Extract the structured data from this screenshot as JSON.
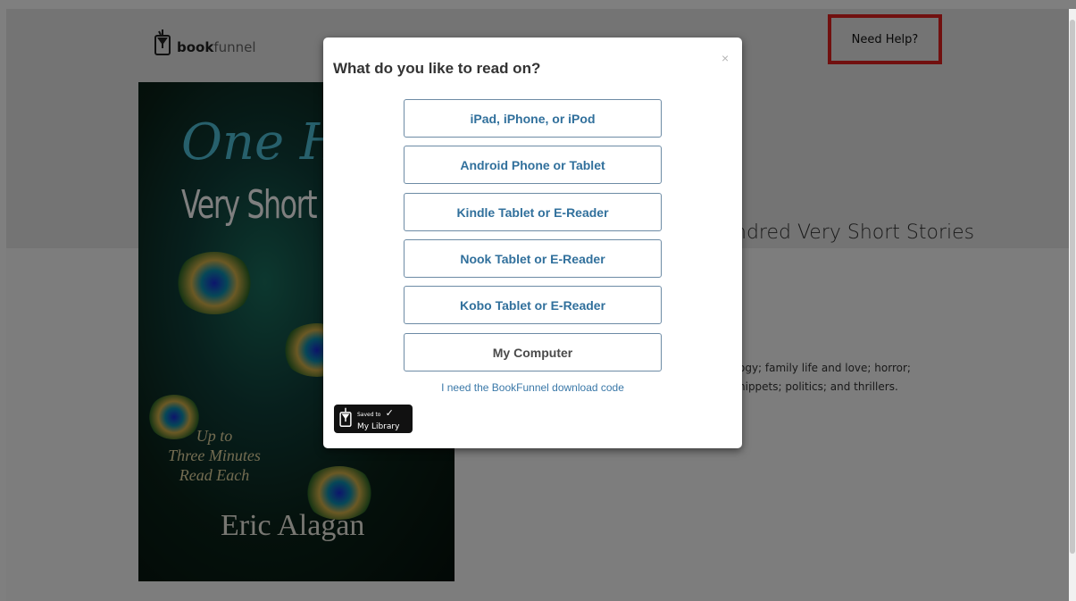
{
  "header": {
    "logo_text_bold": "book",
    "logo_text_light": "funnel",
    "need_help_label": "Need Help?"
  },
  "book": {
    "cover": {
      "title_line1": "One Hu",
      "title_line2": "Very Short S",
      "tagline_lines": [
        "Up to",
        "Three Minutes",
        "Read Each"
      ],
      "author": "Eric Alagan"
    },
    "title_visible": "ndred Very Short Stories",
    "description_lines": [
      "ogy; family life and love; horror;",
      "nippets; politics; and thrillers."
    ]
  },
  "modal": {
    "title": "What do you like to read on?",
    "close_label": "×",
    "options": [
      {
        "label": "iPad, iPhone, or iPod"
      },
      {
        "label": "Android Phone or Tablet"
      },
      {
        "label": "Kindle Tablet or E-Reader"
      },
      {
        "label": "Nook Tablet or E-Reader"
      },
      {
        "label": "Kobo Tablet or E-Reader"
      },
      {
        "label": "My Computer"
      }
    ],
    "code_link_label": "I need the BookFunnel download code",
    "library_badge": {
      "small_text": "Saved to",
      "check": "✓",
      "big_text": "My Library"
    }
  },
  "colors": {
    "accent_link": "#31709c",
    "help_border": "#e2201f"
  }
}
